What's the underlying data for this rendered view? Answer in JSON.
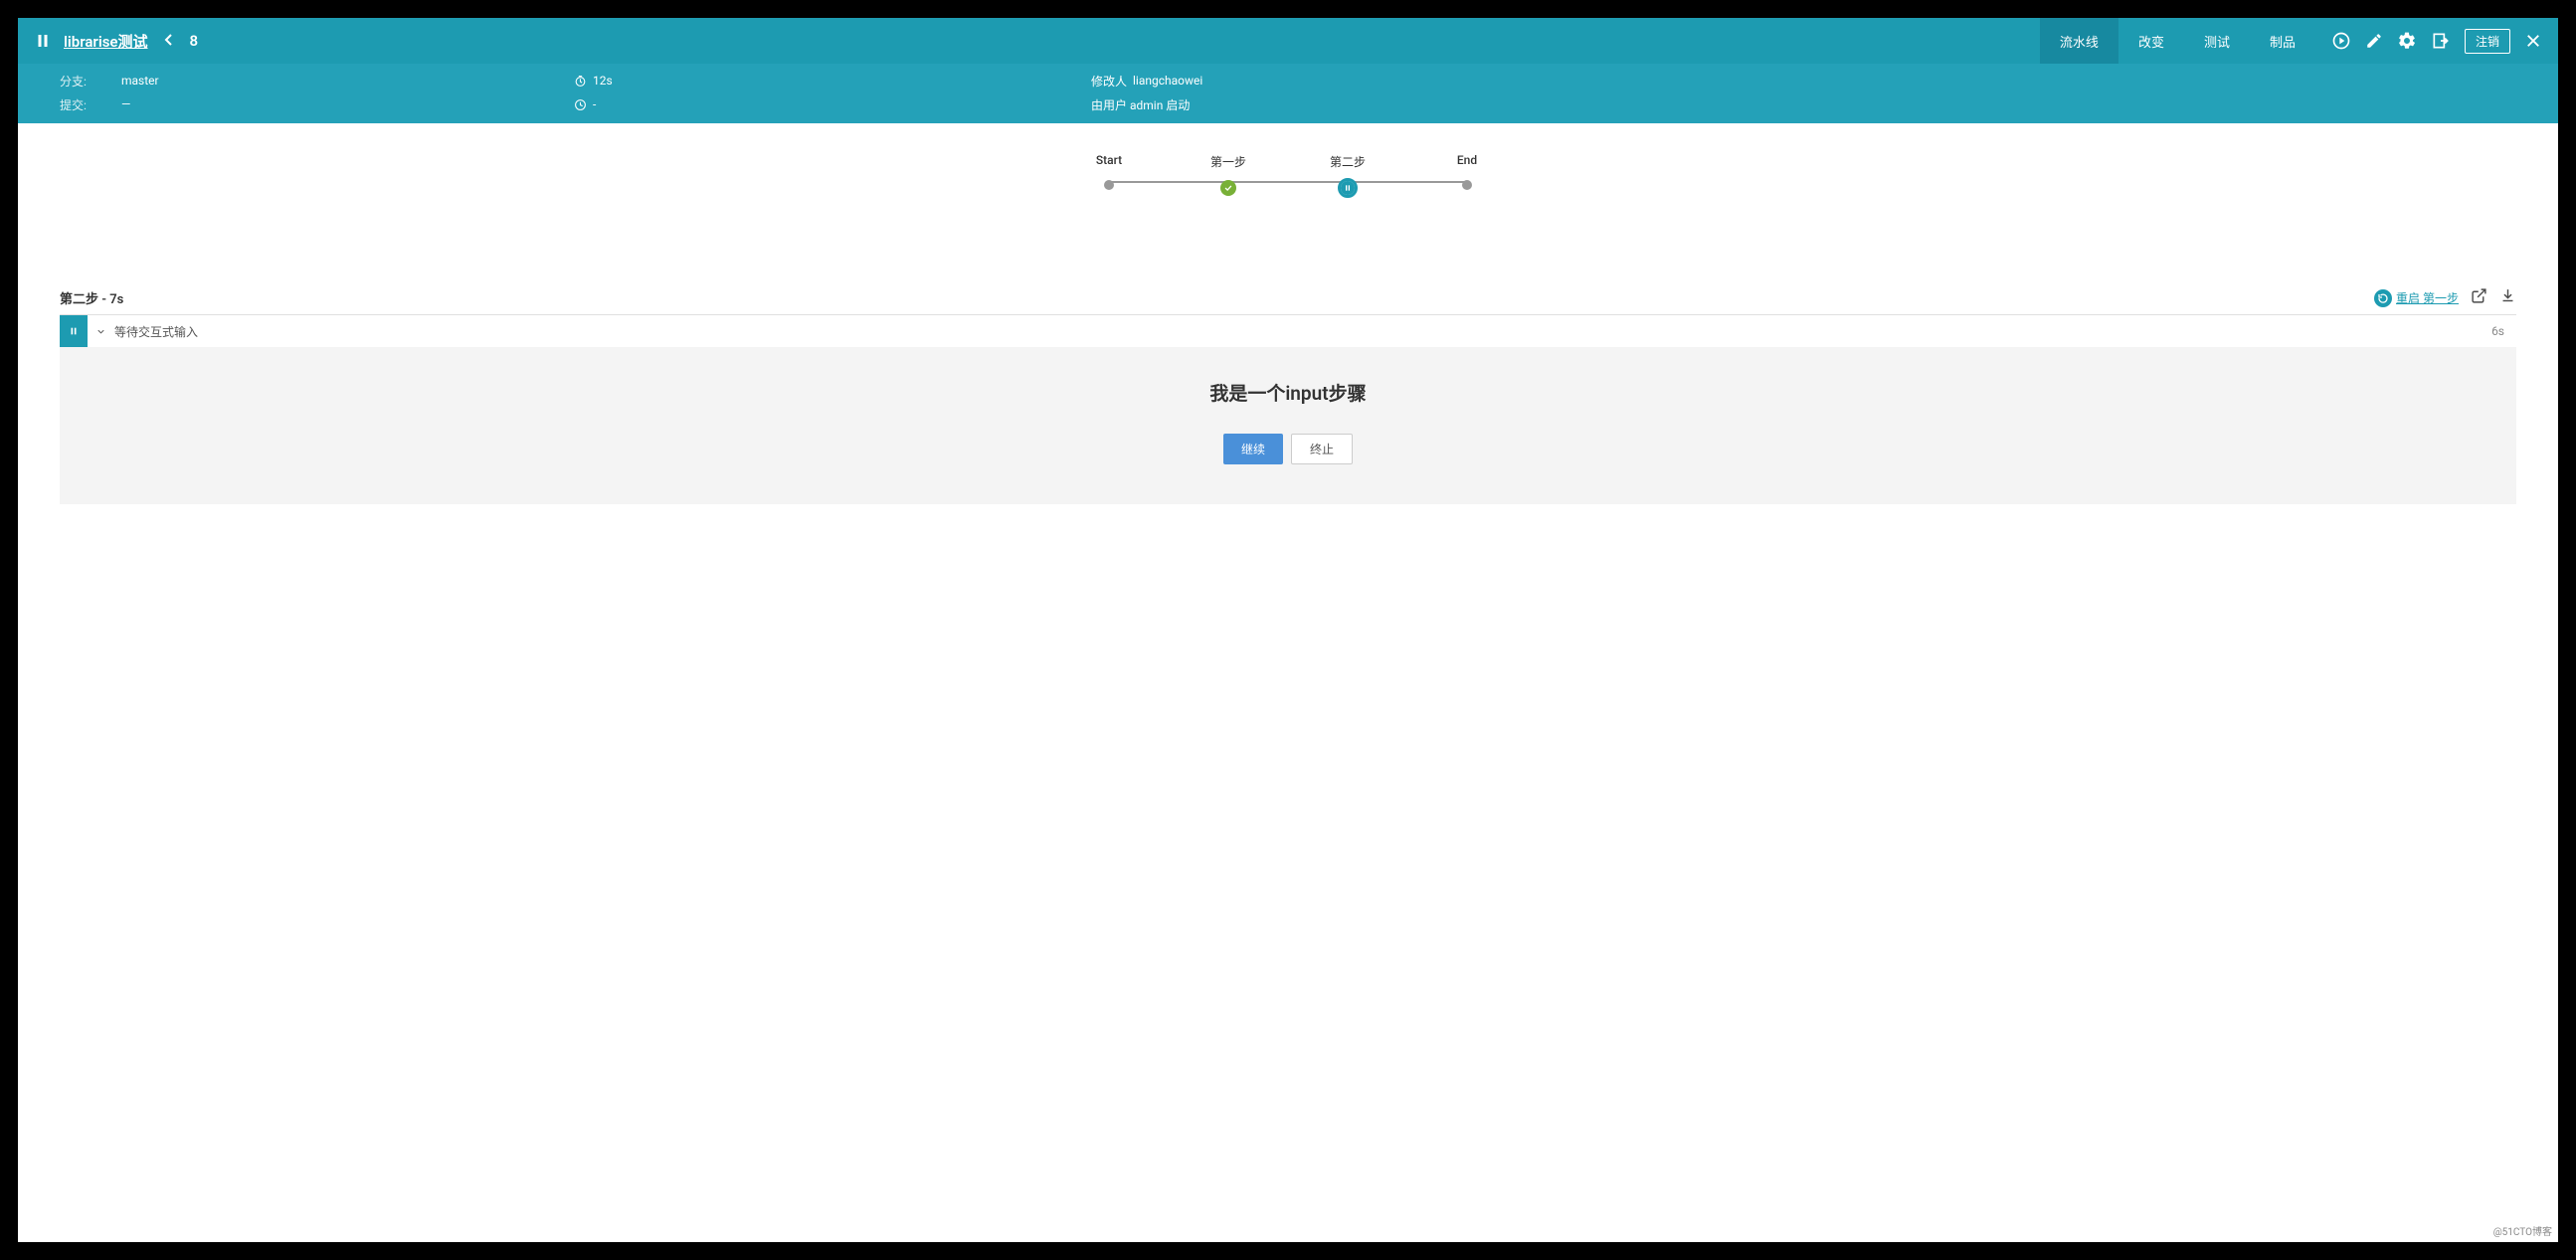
{
  "header": {
    "title": "librarise测试",
    "run_number": "8",
    "tabs": {
      "pipeline": "流水线",
      "changes": "改变",
      "tests": "测试",
      "artifacts": "制品"
    },
    "logout": "注销"
  },
  "details": {
    "branch_label": "分支:",
    "branch_value": "master",
    "commit_label": "提交:",
    "commit_value": "—",
    "duration_value": "12s",
    "time_value": "-",
    "modifier_label": "修改人",
    "modifier_value": "liangchaowei",
    "started_by": "由用户 admin 启动"
  },
  "pipeline": {
    "stages": [
      {
        "label": "Start",
        "state": "dot"
      },
      {
        "label": "第一步",
        "state": "success"
      },
      {
        "label": "第二步",
        "state": "paused"
      },
      {
        "label": "End",
        "state": "dot"
      }
    ]
  },
  "step": {
    "header_title": "第二步 - 7s",
    "restart_label": "重启 第一步",
    "row_label": "等待交互式输入",
    "row_duration": "6s"
  },
  "input_prompt": {
    "message": "我是一个input步骤",
    "continue": "继续",
    "abort": "终止"
  },
  "watermark": "@51CTO博客"
}
